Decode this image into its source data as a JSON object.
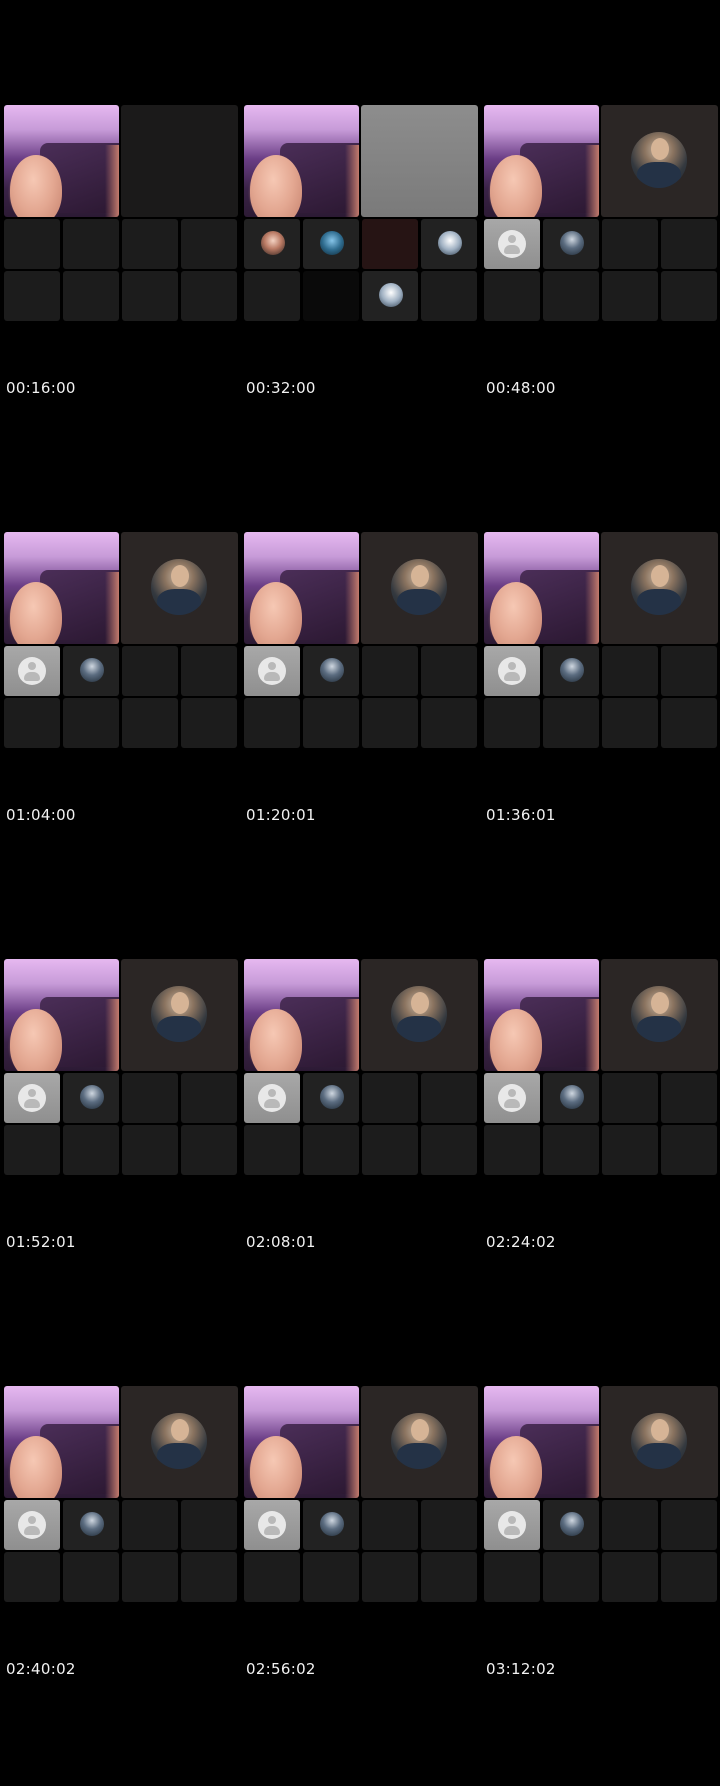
{
  "frames": [
    {
      "timestamp": "00:16:00",
      "second_tile": "empty",
      "small_tiles": [
        "empty",
        "empty",
        "empty",
        "empty",
        "empty",
        "empty",
        "empty",
        "empty"
      ]
    },
    {
      "timestamp": "00:32:00",
      "second_tile": "grey",
      "small_tiles": [
        "photo-warm",
        "photo-blue",
        "red",
        "photo-white",
        "empty",
        "black",
        "photo-white",
        "empty"
      ]
    },
    {
      "timestamp": "00:48:00",
      "second_tile": "avatar-photo",
      "small_tiles": [
        "default-avatar",
        "photo",
        "empty",
        "empty",
        "empty",
        "empty",
        "empty",
        "empty"
      ]
    },
    {
      "timestamp": "01:04:00",
      "second_tile": "avatar-photo",
      "small_tiles": [
        "default-avatar",
        "photo",
        "empty",
        "empty",
        "empty",
        "empty",
        "empty",
        "empty"
      ]
    },
    {
      "timestamp": "01:20:01",
      "second_tile": "avatar-photo",
      "small_tiles": [
        "default-avatar",
        "photo",
        "empty",
        "empty",
        "empty",
        "empty",
        "empty",
        "empty"
      ]
    },
    {
      "timestamp": "01:36:01",
      "second_tile": "avatar-photo",
      "small_tiles": [
        "default-avatar",
        "photo",
        "empty",
        "empty",
        "empty",
        "empty",
        "empty",
        "empty"
      ]
    },
    {
      "timestamp": "01:52:01",
      "second_tile": "avatar-photo",
      "small_tiles": [
        "default-avatar",
        "photo",
        "empty",
        "empty",
        "empty",
        "empty",
        "empty",
        "empty"
      ]
    },
    {
      "timestamp": "02:08:01",
      "second_tile": "avatar-photo",
      "small_tiles": [
        "default-avatar",
        "photo",
        "empty",
        "empty",
        "empty",
        "empty",
        "empty",
        "empty"
      ]
    },
    {
      "timestamp": "02:24:02",
      "second_tile": "avatar-photo",
      "small_tiles": [
        "default-avatar",
        "photo",
        "empty",
        "empty",
        "empty",
        "empty",
        "empty",
        "empty"
      ]
    },
    {
      "timestamp": "02:40:02",
      "second_tile": "avatar-photo",
      "small_tiles": [
        "default-avatar",
        "photo",
        "empty",
        "empty",
        "empty",
        "empty",
        "empty",
        "empty"
      ]
    },
    {
      "timestamp": "02:56:02",
      "second_tile": "avatar-photo",
      "small_tiles": [
        "default-avatar",
        "photo",
        "empty",
        "empty",
        "empty",
        "empty",
        "empty",
        "empty"
      ]
    },
    {
      "timestamp": "03:12:02",
      "second_tile": "avatar-photo",
      "small_tiles": [
        "default-avatar",
        "photo",
        "empty",
        "empty",
        "empty",
        "empty",
        "empty",
        "empty"
      ]
    }
  ],
  "colors": {
    "background": "#000000",
    "tile_empty": "#1c1c1c",
    "timestamp_text": "#f2f2f2"
  }
}
